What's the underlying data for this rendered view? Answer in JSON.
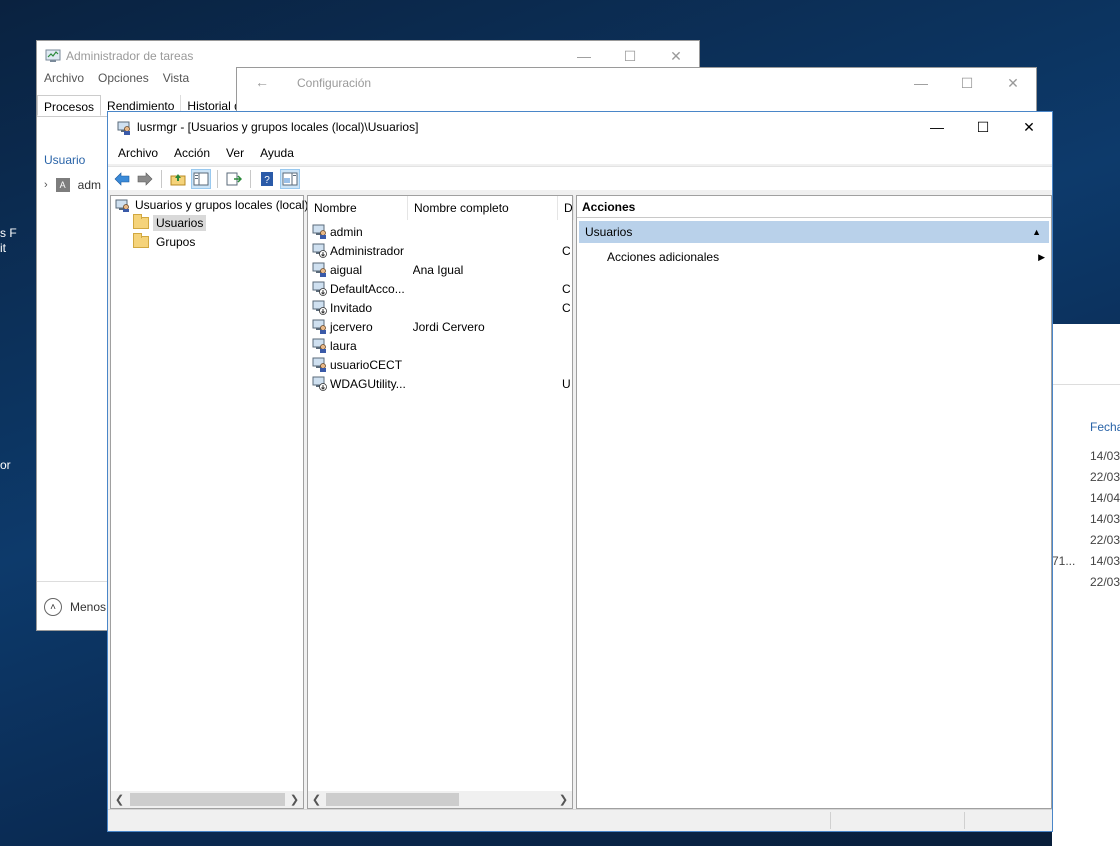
{
  "desktop": {
    "fragments": [
      "s F",
      "it",
      "or"
    ]
  },
  "taskmgr": {
    "title": "Administrador de tareas",
    "menu": [
      "Archivo",
      "Opciones",
      "Vista"
    ],
    "tabs": [
      "Procesos",
      "Rendimiento",
      "Historial d"
    ],
    "column_user": "Usuario",
    "user_row": "adm",
    "fewer_details": "Menos"
  },
  "config": {
    "title": "Configuración"
  },
  "bg_right": {
    "fecha_header": "Fecha",
    "dates": [
      "14/03",
      "22/03",
      "14/04",
      "14/03",
      "22/03",
      "14/03",
      "22/03"
    ],
    "fragment": "71..."
  },
  "lusrmgr": {
    "title": "lusrmgr - [Usuarios y grupos locales (local)\\Usuarios]",
    "menu": [
      "Archivo",
      "Acción",
      "Ver",
      "Ayuda"
    ],
    "tree": {
      "root": "Usuarios y grupos locales (local)",
      "children": [
        "Usuarios",
        "Grupos"
      ]
    },
    "list": {
      "columns": [
        "Nombre",
        "Nombre completo",
        "D"
      ],
      "rows": [
        {
          "name": "admin",
          "full": "",
          "desc": ""
        },
        {
          "name": "Administrador",
          "full": "",
          "desc": "C"
        },
        {
          "name": "aigual",
          "full": "Ana Igual",
          "desc": ""
        },
        {
          "name": "DefaultAcco...",
          "full": "",
          "desc": "C"
        },
        {
          "name": "Invitado",
          "full": "",
          "desc": "C"
        },
        {
          "name": "jcervero",
          "full": "Jordi Cervero",
          "desc": ""
        },
        {
          "name": "laura",
          "full": "",
          "desc": ""
        },
        {
          "name": "usuarioCECT",
          "full": "",
          "desc": ""
        },
        {
          "name": "WDAGUtility...",
          "full": "",
          "desc": "U"
        }
      ]
    },
    "actions": {
      "header": "Acciones",
      "section": "Usuarios",
      "item": "Acciones adicionales"
    }
  },
  "colors": {
    "desktop": "#0d3a6b",
    "selection": "#b9d1ea",
    "accent_border": "#4a86c8"
  }
}
